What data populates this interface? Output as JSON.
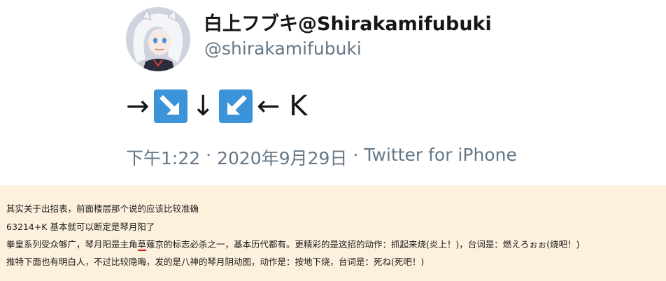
{
  "tweet": {
    "display_name": "白上フブキ@Shirakamifubuki",
    "handle": "@shirakamifubuki",
    "command": {
      "arrow_right": "→",
      "key_down_right_icon": "down-right-arrow-key",
      "arrow_down": "↓",
      "key_down_left_icon": "down-left-arrow-key",
      "arrow_left_k": "← K"
    },
    "time": "下午1:22",
    "sep1": "·",
    "date": "2020年9月29日",
    "sep2": "·",
    "source": "Twitter for iPhone"
  },
  "comment": {
    "line1": "其实关于出招表，前面楼层那个说的应该比较准确",
    "line2": "63214+K 基本就可以断定是琴月阳了",
    "line3_a": "拳皇系列受众够广，琴月阳是主角",
    "line3_u": "草",
    "line3_b": "薙京的标志必杀之一，基本历代都有。更精彩的是这招的动作：抓起来烧(炎上！)，台词是：燃えろぉぉ(烧吧！)",
    "line4": "推特下面也有明白人，不过比较隐晦，发的是八神的琴月阴动图，动作是：按地下烧，台词是：死ね(死吧！)"
  },
  "colors": {
    "key_blue": "#3b94d9",
    "comment_bg": "#fdf1dd",
    "muted_text": "#657786"
  }
}
